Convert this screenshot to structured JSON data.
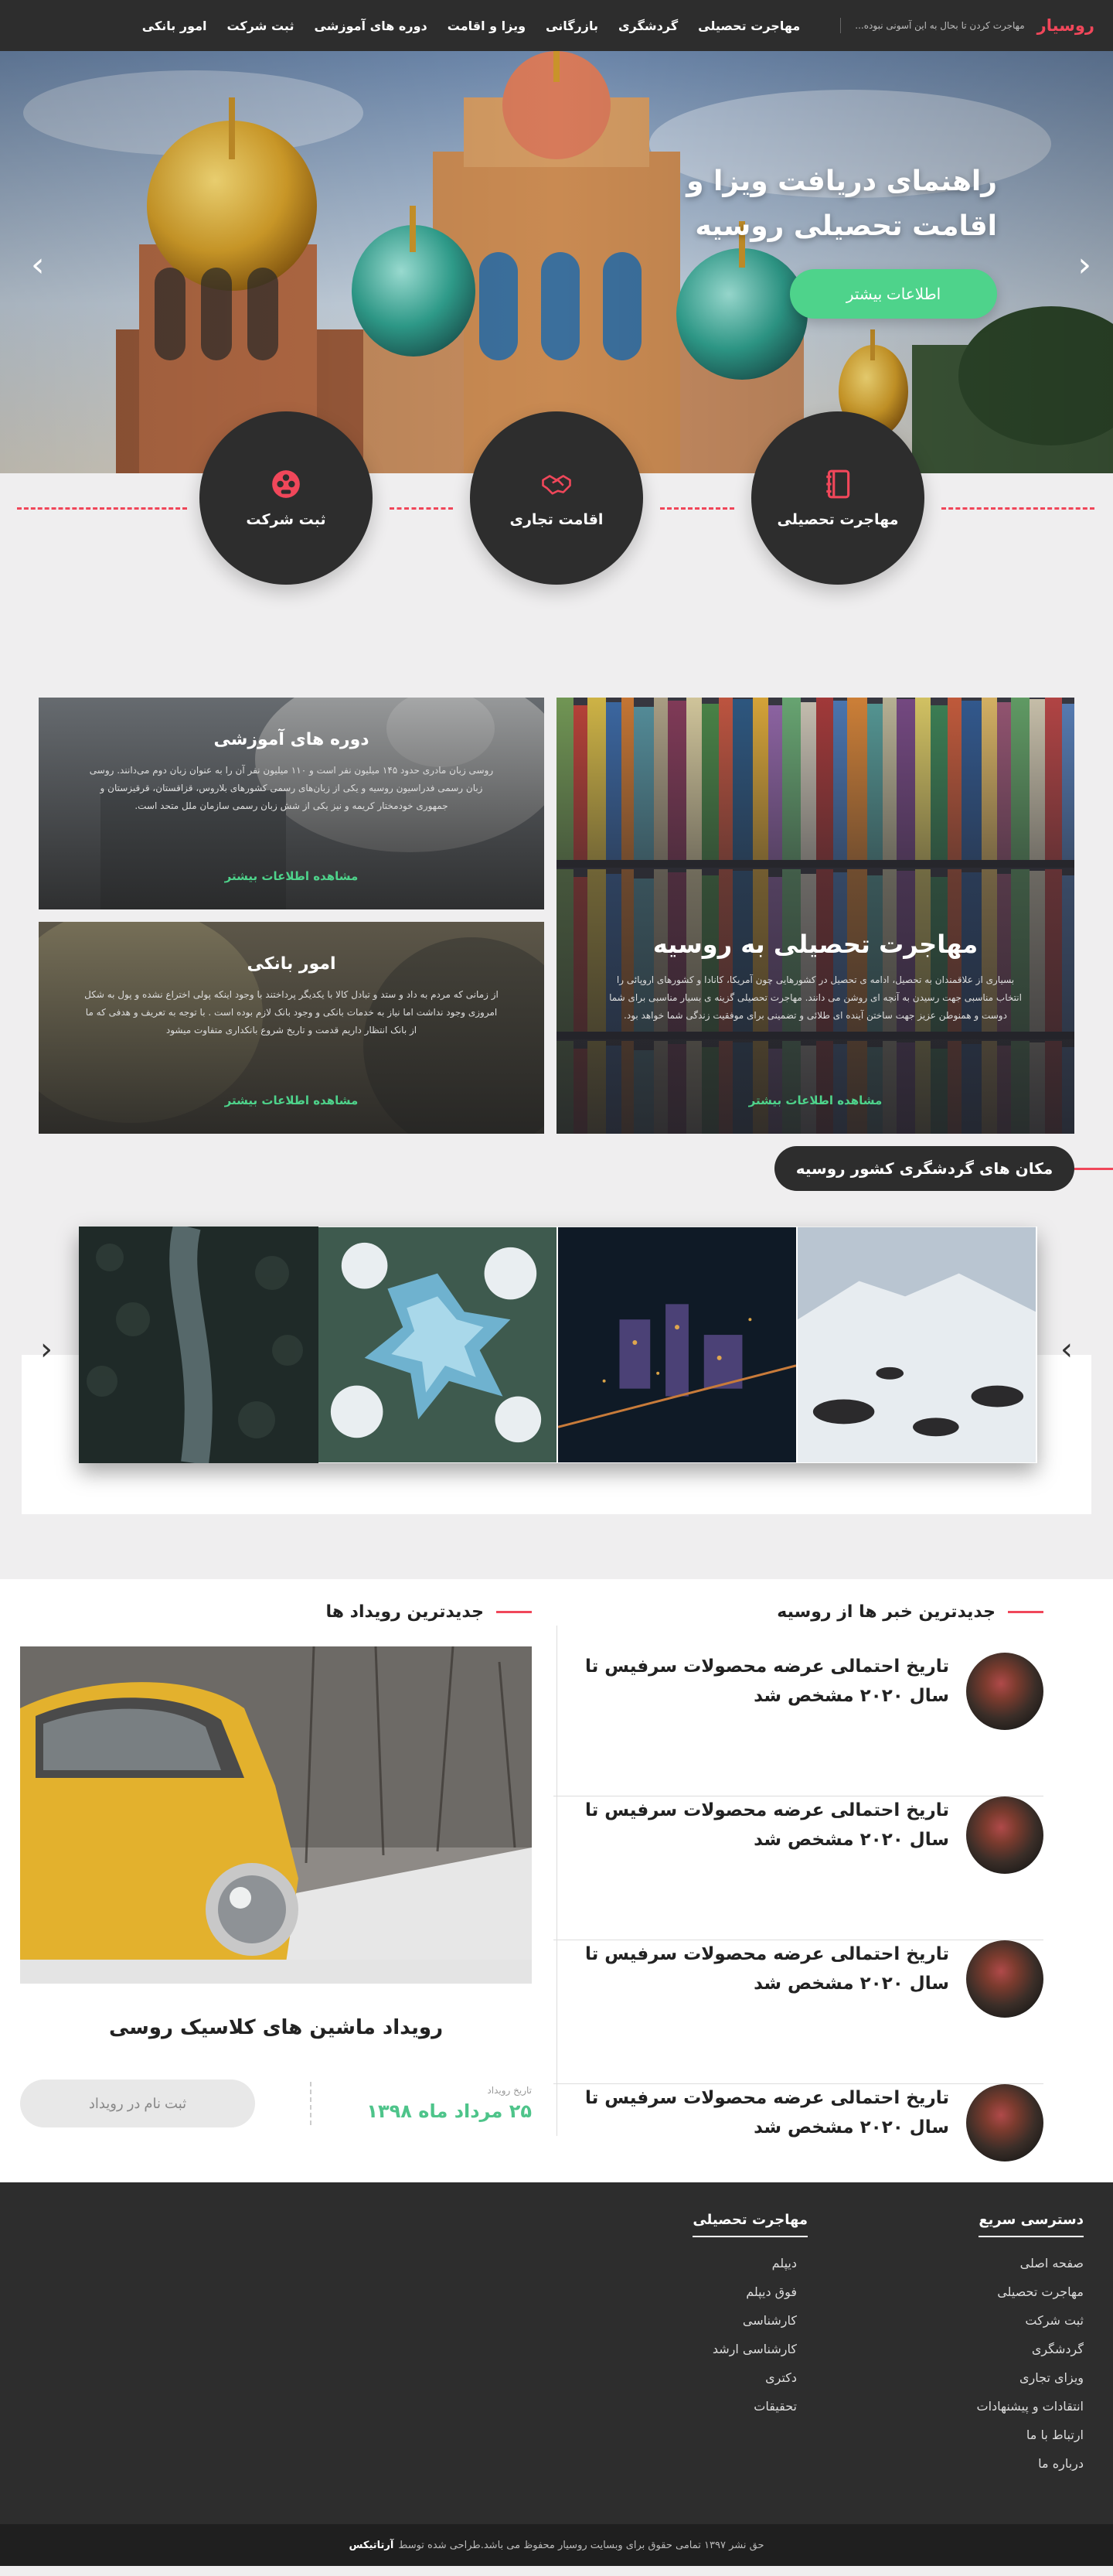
{
  "nav": {
    "brand": "روسیار",
    "tagline": "مهاجرت کردن تا بحال به این آسونی نبوده...",
    "menu": [
      "مهاجرت تحصیلی",
      "گردشگری",
      "بازرگانی",
      "ویزا و اقامت",
      "دوره های آموزشی",
      "ثبت شرکت",
      "امور بانکی"
    ]
  },
  "hero": {
    "title": "راهنمای دریافت ویزا و اقامت تحصیلی روسیه",
    "button": "اطلاعات بیشتر"
  },
  "circles": [
    {
      "label": "مهاجرت تحصیلی",
      "icon": "notebook-icon"
    },
    {
      "label": "اقامت تجاری",
      "icon": "handshake-icon"
    },
    {
      "label": "ثبت شرکت",
      "icon": "company-icon"
    }
  ],
  "services": {
    "big": {
      "title": "مهاجرت تحصیلی به روسیه",
      "text": "بسیاری از علاقمندان به تحصیل، ادامه ی تحصیل در کشورهایی چون آمریکا، کانادا و کشورهای اروپائی را انتخاب مناسبی جهت رسیدن به آنچه ای روشن می دانند. مهاجرت تحصیلی گزینه ی بسیار مناسبی برای شما دوست و همنوطن عزیز جهت ساختن آینده ای طلائی و تضمینی برای موفقیت زندگی شما خواهد بود.",
      "more": "مشاهده اطلاعات بیشتر"
    },
    "courses": {
      "title": "دوره های آموزشی",
      "text": "روسی زبان مادری حدود ۱۴۵ میلیون نفر است و ۱۱۰ میلیون نفر آن را به عنوان زبان دوم می‌دانند. روسی زبان رسمی فدراسیون روسیه و یکی از زبان‌های رسمی کشورهای بلاروس، قزاقستان، قرقیزستان و جمهوری خودمختار کریمه و نیز یکی از شش زبان رسمی سازمان ملل متحد است.",
      "more": "مشاهده اطلاعات بیشتر"
    },
    "bank": {
      "title": "امور بانکی",
      "text": "از زمانی که مردم به داد و ستد و تبادل کالا با یکدیگر پرداختند با وجود اینکه پولی اختراع نشده و پول به شکل امروزی وجود نداشت اما نیاز به خدمات بانکی و وجود بانک لازم بوده است . با توجه به تعریف و هدفی که ما از بانک انتظار داریم قدمت و تاریخ شروع بانکداری متفاوت میشود",
      "more": "مشاهده اطلاعات بیشتر"
    }
  },
  "tourism": {
    "title": "مکان های گردشگری کشور روسیه"
  },
  "news": {
    "heading": "جدیدترین خبر ها از روسیه",
    "items": [
      "تاریخ احتمالی عرضه محصولات سرفیس تا سال ۲۰۲۰ مشخص شد",
      "تاریخ احتمالی عرضه محصولات سرفیس تا سال ۲۰۲۰ مشخص شد",
      "تاریخ احتمالی عرضه محصولات سرفیس تا سال ۲۰۲۰ مشخص شد",
      "تاریخ احتمالی عرضه محصولات سرفیس تا سال ۲۰۲۰ مشخص شد"
    ]
  },
  "events": {
    "heading": "جدیدترین رویداد ها",
    "title": "رویداد ماشین های کلاسیک روسی",
    "date_label": "تاریخ رویداد",
    "date": "۲۵ مرداد ماه ۱۳۹۸",
    "button": "ثبت نام در رویداد"
  },
  "footer": {
    "quick": {
      "title": "دسترسی سریع",
      "links": [
        "صفحه اصلی",
        "مهاجرت تحصیلی",
        "ثبت شرکت",
        "گردشگری",
        "ویزای تجاری",
        "انتقادات و پیشنهادات",
        "ارتباط با ما",
        "درباره ما"
      ]
    },
    "edu": {
      "title": "مهاجرت تحصیلی",
      "links": [
        "دیپلم",
        "فوق دیپلم",
        "کارشناسی",
        "کارشناسی ارشد",
        "دکتری",
        "تحقیقات"
      ]
    },
    "copyright": "حق نشر ۱۳۹۷ تمامی حقوق برای وبسایت روسیار محفوظ می باشد.طراحی شده توسط",
    "designer": "آرتاتیکس"
  },
  "colors": {
    "accent": "#f0475a",
    "green": "#4ed38b",
    "dark": "#2d2d2d"
  }
}
